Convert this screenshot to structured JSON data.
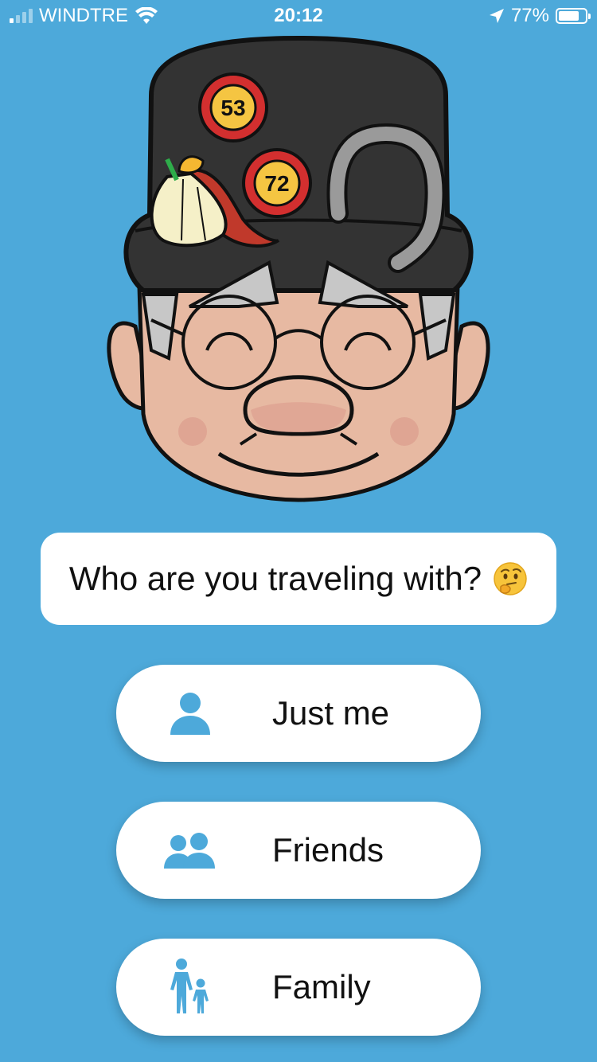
{
  "status_bar": {
    "carrier": "WINDTRE",
    "time": "20:12",
    "battery_percent": "77%",
    "battery_level": 0.77,
    "icons": [
      "signal-icon",
      "wifi-icon",
      "location-arrow-icon",
      "battery-icon"
    ]
  },
  "mascot": {
    "badges": [
      "53",
      "72"
    ],
    "icon": "old-man-mascot-icon"
  },
  "prompt": {
    "question": "Who are you traveling with?",
    "emoji": "thinking-face-icon"
  },
  "options": [
    {
      "label": "Just me",
      "icon": "person-icon"
    },
    {
      "label": "Friends",
      "icon": "two-people-icon"
    },
    {
      "label": "Family",
      "icon": "adult-child-icon"
    }
  ],
  "colors": {
    "background": "#4DA9DA",
    "card": "#FFFFFF",
    "icon_accent": "#4DA9DA"
  }
}
